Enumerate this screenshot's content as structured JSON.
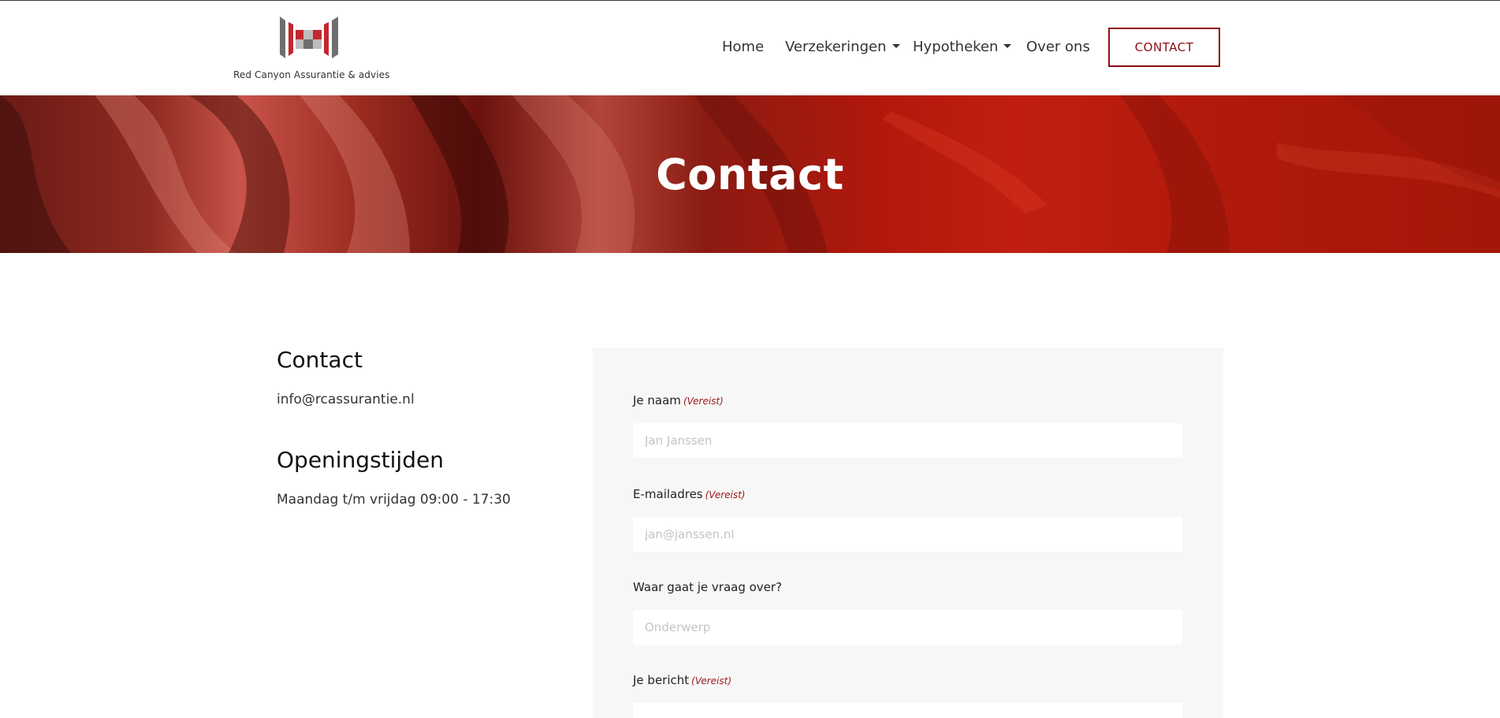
{
  "brand": {
    "logo_text": "Red Canyon Assurantie & advies"
  },
  "nav": {
    "home": "Home",
    "verzekeringen": "Verzekeringen",
    "hypotheken": "Hypotheken",
    "over_ons": "Over ons",
    "contact_button": "CONTACT"
  },
  "hero": {
    "title": "Contact"
  },
  "info": {
    "contact_heading": "Contact",
    "email": "info@rcassurantie.nl",
    "hours_heading": "Openingstijden",
    "hours": "Maandag t/m vrijdag 09:00 - 17:30"
  },
  "form": {
    "required_label": "(Vereist)",
    "name": {
      "label": "Je naam",
      "placeholder": "Jan Janssen"
    },
    "email": {
      "label": "E-mailadres",
      "placeholder": "jan@janssen.nl"
    },
    "subject": {
      "label": "Waar gaat je vraag over?",
      "placeholder": "Onderwerp"
    },
    "message": {
      "label": "Je bericht"
    }
  },
  "colors": {
    "accent": "#8f0d13",
    "panel": "#f7f7f7"
  }
}
